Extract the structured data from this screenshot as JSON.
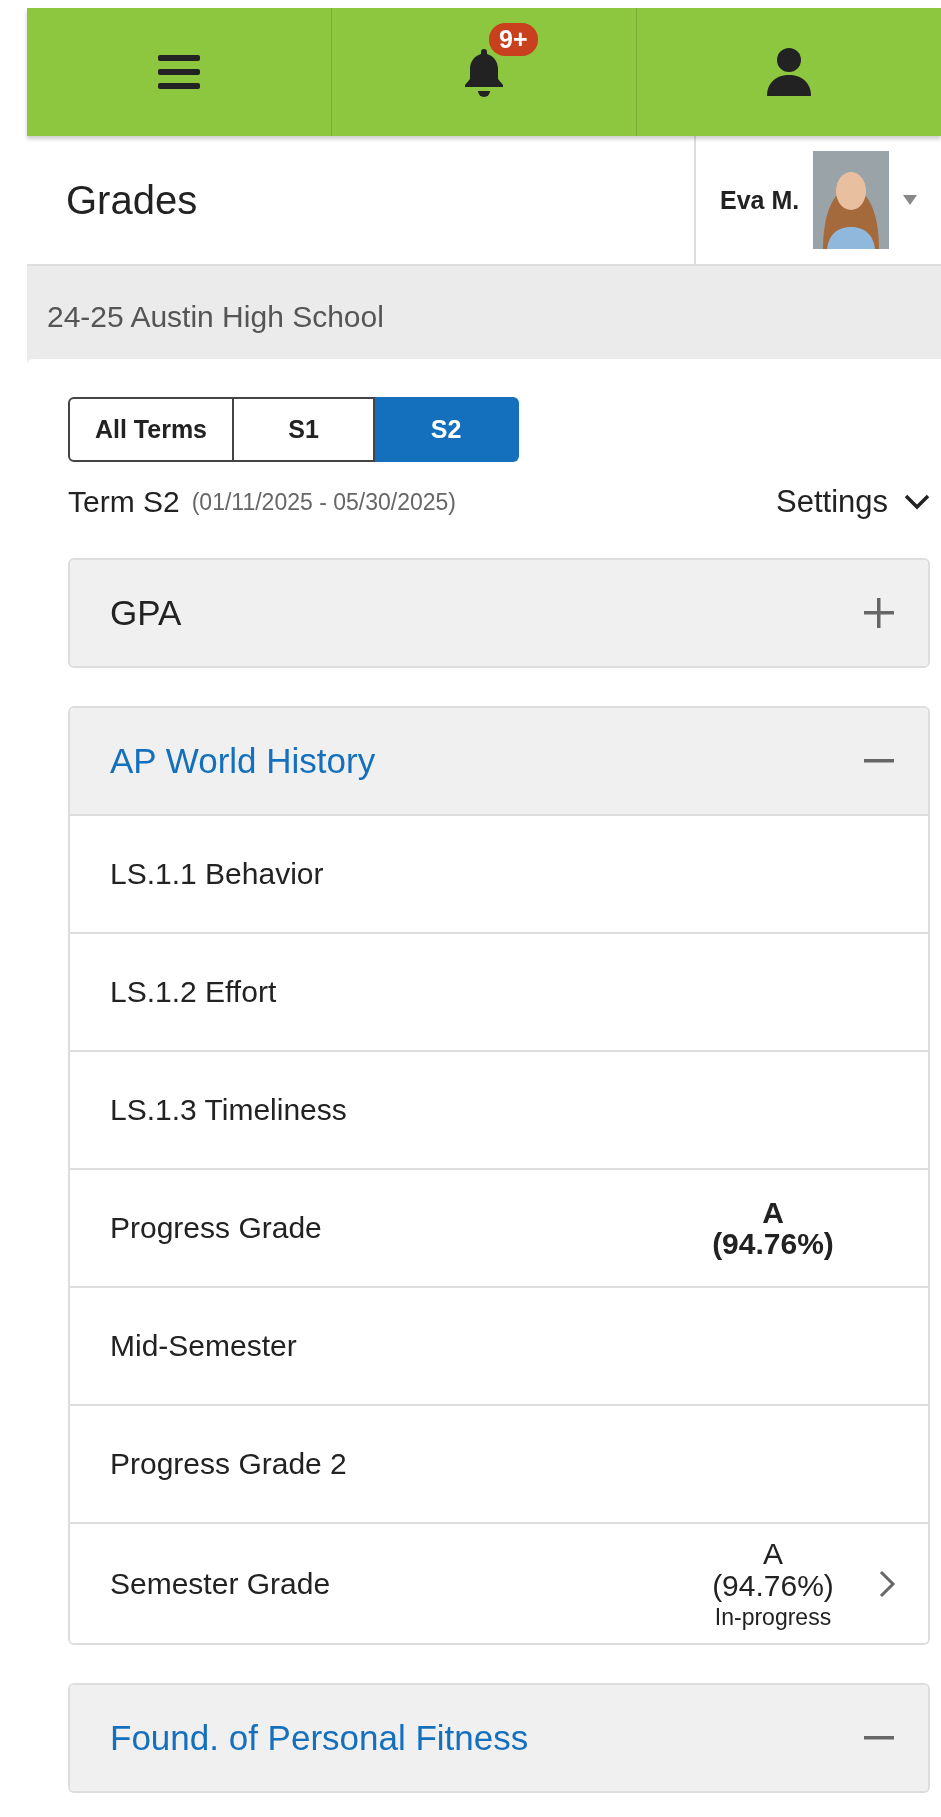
{
  "top_bar": {
    "notification_badge": "9+"
  },
  "header": {
    "title": "Grades",
    "user_name": "Eva M."
  },
  "school": "24-25 Austin High School",
  "term_tabs": [
    {
      "label": "All Terms",
      "selected": false
    },
    {
      "label": "S1",
      "selected": false
    },
    {
      "label": "S2",
      "selected": true
    }
  ],
  "term": {
    "label": "Term S2",
    "dates": "(01/11/2025 - 05/30/2025)",
    "settings": "Settings"
  },
  "sections": [
    {
      "kind": "gpa",
      "title": "GPA",
      "expanded": false
    },
    {
      "kind": "course",
      "title": "AP World History",
      "expanded": true,
      "rows": [
        {
          "label": "LS.1.1 Behavior",
          "has_detail": false
        },
        {
          "label": "LS.1.2 Effort",
          "has_detail": false
        },
        {
          "label": "LS.1.3 Timeliness",
          "has_detail": false
        },
        {
          "label": "Progress Grade",
          "grade": "A",
          "percent": "(94.76%)",
          "bold": true,
          "has_detail": false
        },
        {
          "label": "Mid-Semester",
          "has_detail": false
        },
        {
          "label": "Progress Grade 2",
          "has_detail": false
        },
        {
          "label": "Semester Grade",
          "grade": "A",
          "percent": "(94.76%)",
          "status": "In-progress",
          "bold": false,
          "has_detail": true
        }
      ]
    },
    {
      "kind": "course",
      "title": "Found. of Personal Fitness",
      "expanded": true
    }
  ]
}
